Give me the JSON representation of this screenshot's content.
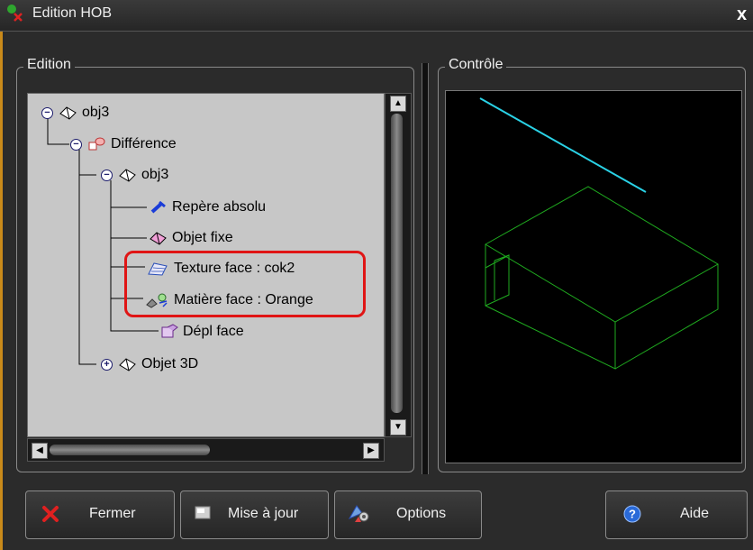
{
  "window": {
    "title": "Edition HOB",
    "close": "x"
  },
  "groups": {
    "edition": "Edition",
    "controle": "Contrôle"
  },
  "tree": {
    "nodes": [
      {
        "label": "obj3",
        "icon": "solid-object-icon"
      },
      {
        "label": "Différence",
        "icon": "difference-icon"
      },
      {
        "label": "obj3",
        "icon": "solid-object-icon"
      },
      {
        "label": "Repère absolu",
        "icon": "axis-marker-icon"
      },
      {
        "label": "Objet fixe",
        "icon": "fixed-object-icon"
      },
      {
        "label": "Texture face : cok2",
        "icon": "texture-icon"
      },
      {
        "label": "Matière face : Orange",
        "icon": "material-icon"
      },
      {
        "label": "Dépl face",
        "icon": "displacement-icon"
      },
      {
        "label": "Objet 3D",
        "icon": "object-3d-icon"
      }
    ],
    "expanded_marker": "−",
    "collapsed_marker": "+"
  },
  "buttons": {
    "close": "Fermer",
    "update": "Mise à jour",
    "options": "Options",
    "help": "Aide"
  },
  "colors": {
    "highlight": "#e01515",
    "wireframe_box": "#1faa1f",
    "wireframe_line": "#2ad2e6",
    "tree_background": "#c7c7c7",
    "window_background": "#2b2b2b"
  }
}
